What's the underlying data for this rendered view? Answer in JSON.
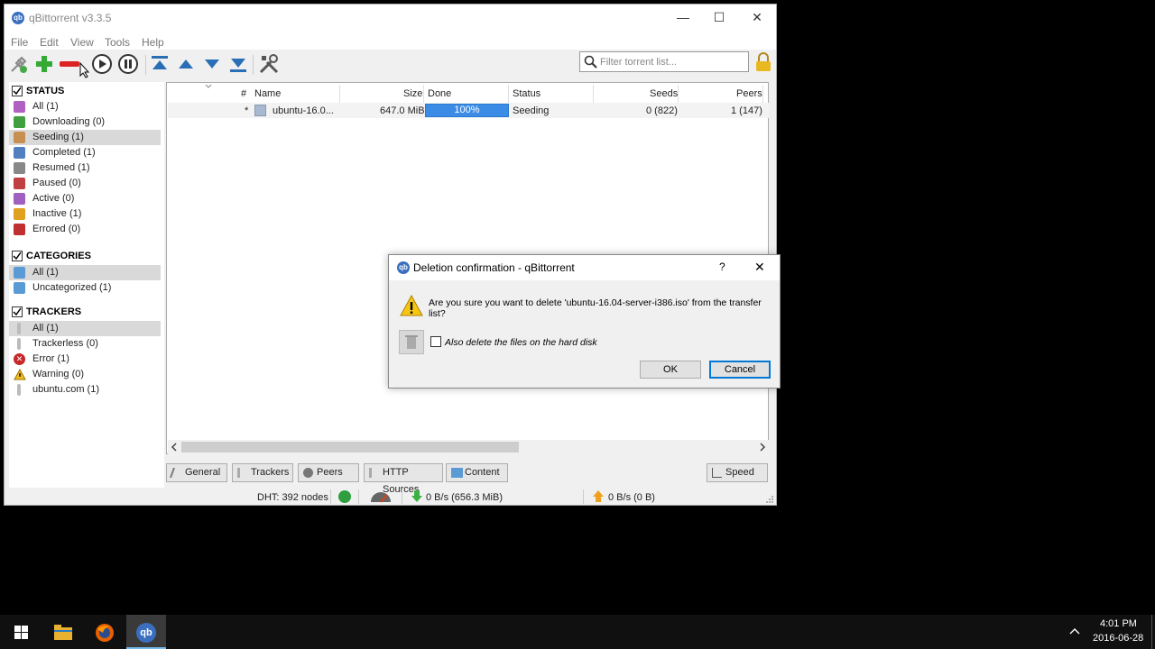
{
  "window": {
    "title": "qBittorrent v3.3.5",
    "app_icon": "qb",
    "controls": {
      "minimize": "—",
      "maximize": "☐",
      "close": "✕"
    }
  },
  "menu": [
    "File",
    "Edit",
    "View",
    "Tools",
    "Help"
  ],
  "toolbar": {
    "icons": [
      "add-link-icon",
      "add-torrent-icon",
      "delete-icon",
      "resume-icon",
      "pause-icon",
      "top-priority-icon",
      "increase-priority-icon",
      "decrease-priority-icon",
      "bottom-priority-icon",
      "options-icon",
      "lock-icon"
    ],
    "filter_placeholder": "Filter torrent list..."
  },
  "sidebar": {
    "status": {
      "heading": "STATUS",
      "items": [
        {
          "label": "All (1)",
          "color": "#b060c0"
        },
        {
          "label": "Downloading (0)",
          "color": "#40a040"
        },
        {
          "label": "Seeding (1)",
          "color": "#c89050",
          "selected": true
        },
        {
          "label": "Completed (1)",
          "color": "#5080c0"
        },
        {
          "label": "Resumed (1)",
          "color": "#888888"
        },
        {
          "label": "Paused (0)",
          "color": "#c04040"
        },
        {
          "label": "Active (0)",
          "color": "#a060c0"
        },
        {
          "label": "Inactive (1)",
          "color": "#e0a020"
        },
        {
          "label": "Errored (0)",
          "color": "#c03030"
        }
      ]
    },
    "categories": {
      "heading": "CATEGORIES",
      "items": [
        {
          "label": "All (1)",
          "selected": true
        },
        {
          "label": "Uncategorized (1)"
        }
      ]
    },
    "trackers": {
      "heading": "TRACKERS",
      "items": [
        {
          "label": "All (1)",
          "selected": true
        },
        {
          "label": "Trackerless (0)"
        },
        {
          "label": "Error (1)"
        },
        {
          "label": "Warning (0)"
        },
        {
          "label": "ubuntu.com (1)"
        }
      ]
    }
  },
  "table": {
    "columns": [
      "#",
      "Name",
      "Size",
      "Done",
      "Status",
      "Seeds",
      "Peers"
    ],
    "rows": [
      {
        "num": "*",
        "name": "ubuntu-16.0...",
        "size": "647.0 MiB",
        "done": "100%",
        "done_fraction": 1.0,
        "status": "Seeding",
        "seeds": "0 (822)",
        "peers": "1 (147)"
      }
    ]
  },
  "tabs": [
    "General",
    "Trackers",
    "Peers",
    "HTTP Sources",
    "Content",
    "Speed"
  ],
  "statusbar": {
    "dht": "DHT: 392 nodes",
    "download": "0 B/s (656.3 MiB)",
    "upload": "0 B/s (0 B)"
  },
  "dialog": {
    "title": "Deletion confirmation - qBittorrent",
    "help": "?",
    "close": "✕",
    "message_line1": "Are you sure you want to delete 'ubuntu-16.04-server-i386.iso' from the transfer",
    "message_line2": "list?",
    "checkbox_label": "Also delete the files on the hard disk",
    "checkbox_checked": false,
    "ok": "OK",
    "cancel": "Cancel"
  },
  "taskbar": {
    "time": "4:01 PM",
    "date": "2016-06-28",
    "apps": [
      "windows-start-icon",
      "file-explorer-icon",
      "firefox-icon",
      "qbittorrent-icon"
    ]
  },
  "colors": {
    "progress": "#3c8ce6",
    "accent": "#0078d7"
  }
}
